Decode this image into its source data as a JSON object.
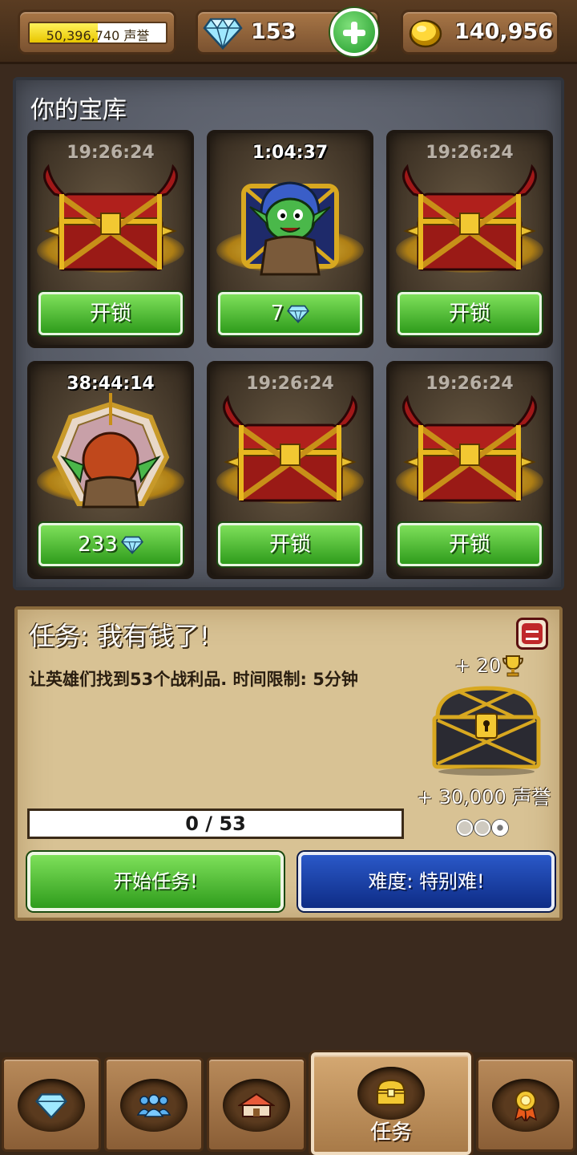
{
  "top_bar": {
    "fame_value": "50,396,740",
    "fame_unit": "声誉",
    "fame_fill_percent": 50,
    "gems": "153",
    "gold": "140,956"
  },
  "vault": {
    "title": "你的宝库",
    "slots": [
      {
        "timer": "19:26:24",
        "timer_style": "dim",
        "kind": "demon-chest",
        "button_label": "开锁"
      },
      {
        "timer": "1:04:37",
        "timer_style": "bright",
        "kind": "goblin-chest",
        "button_label": "7",
        "button_icon": "diamond-icon"
      },
      {
        "timer": "19:26:24",
        "timer_style": "dim",
        "kind": "demon-chest",
        "button_label": "开锁"
      },
      {
        "timer": "38:44:14",
        "timer_style": "bright",
        "kind": "unicorn-goblin-chest",
        "button_label": "233",
        "button_icon": "diamond-icon"
      },
      {
        "timer": "19:26:24",
        "timer_style": "dim",
        "kind": "demon-chest",
        "button_label": "开锁"
      },
      {
        "timer": "19:26:24",
        "timer_style": "dim",
        "kind": "demon-chest",
        "button_label": "开锁"
      }
    ]
  },
  "quest": {
    "title": "任务: 我有钱了!",
    "description": "让英雄们找到53个战利品. 时间限制: 5分钟",
    "trophy_reward": "+ 20",
    "fame_reward": "+ 30,000 声誉",
    "progress_text": "0 / 53",
    "start_label": "开始任务!",
    "difficulty_label": "难度: 特别难!",
    "difficulty_level": 3,
    "difficulty_max": 3
  },
  "bottom_nav": {
    "tabs": [
      {
        "icon": "diamond-icon",
        "label": ""
      },
      {
        "icon": "heroes-icon",
        "label": ""
      },
      {
        "icon": "buildings-icon",
        "label": ""
      },
      {
        "icon": "treasure-chest-icon",
        "label": "任务",
        "active": true
      },
      {
        "icon": "medal-icon",
        "label": ""
      }
    ]
  },
  "colors": {
    "green_button": "#2f9c1c",
    "blue_button": "#0e2c86",
    "parchment": "#d8c294",
    "vault_stone": "#5a5e68"
  }
}
